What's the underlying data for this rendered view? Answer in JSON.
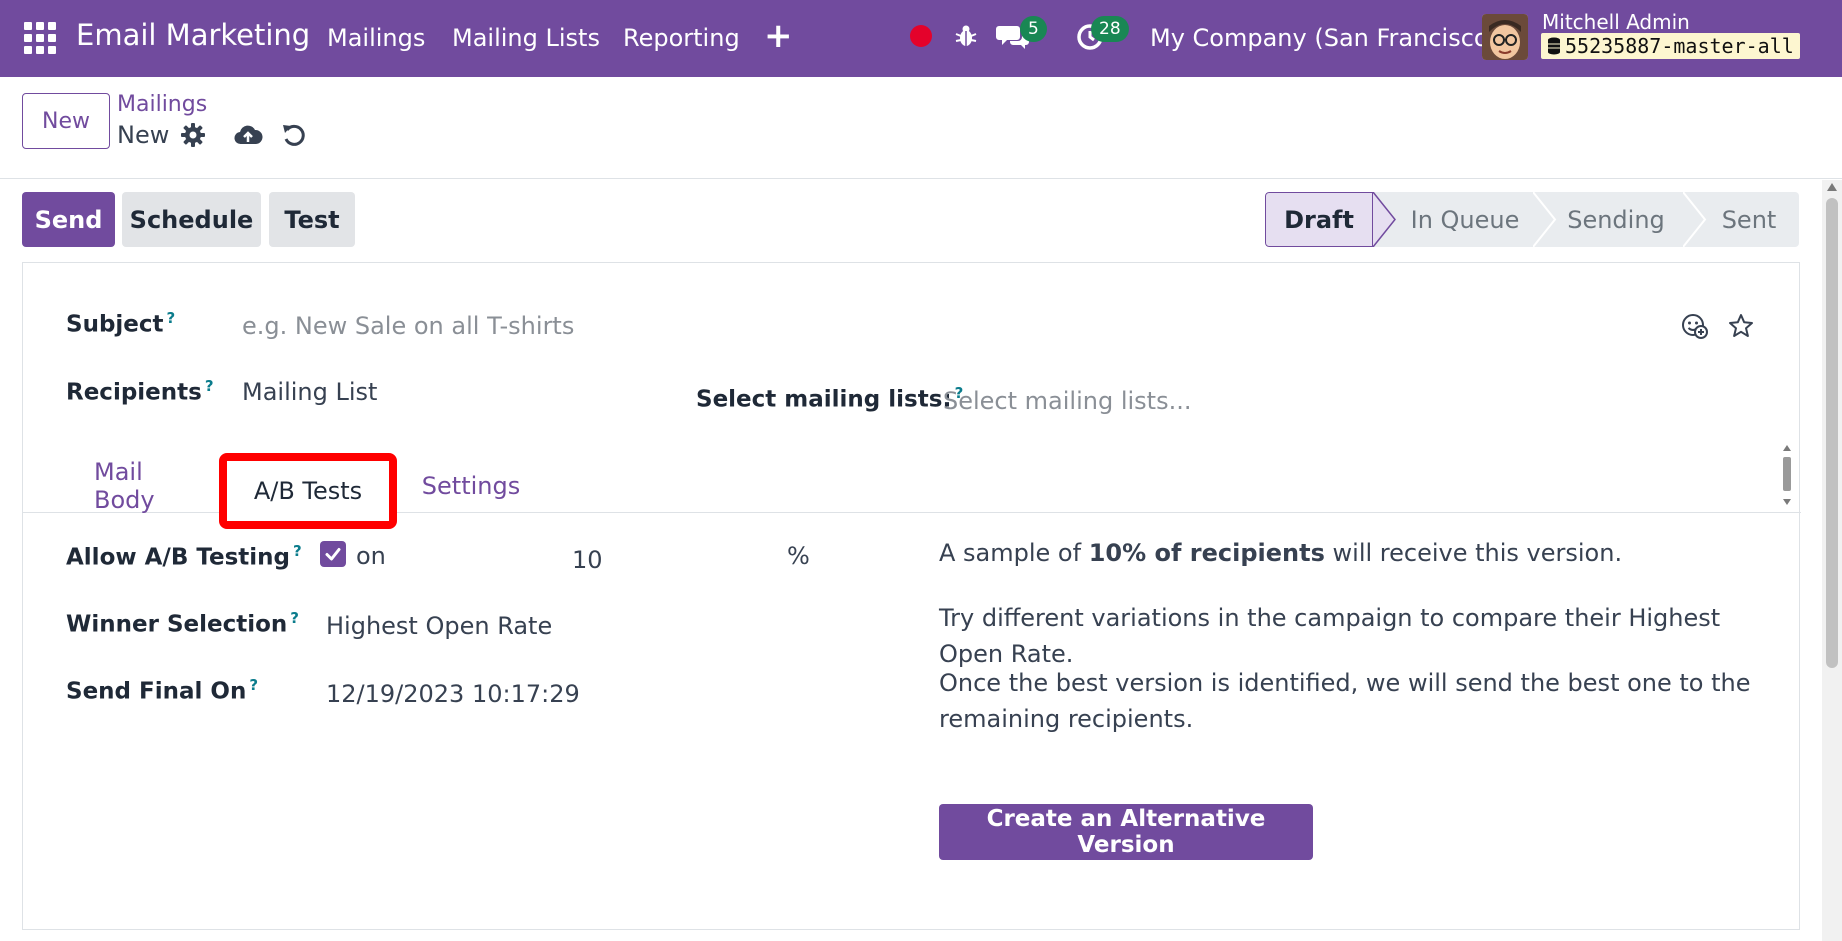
{
  "navbar": {
    "brand": "Email Marketing",
    "menu": [
      "Mailings",
      "Mailing Lists",
      "Reporting"
    ],
    "messages_count": "5",
    "activities_count": "28",
    "company": "My Company (San Francisco)",
    "user_name": "Mitchell Admin",
    "database": "55235887-master-all",
    "colors": {
      "brand": "#714b9e",
      "recording": "#e4022b",
      "badge": "#198754"
    }
  },
  "control_panel": {
    "new_label": "New",
    "breadcrumb_parent": "Mailings",
    "breadcrumb_current": "New"
  },
  "actions": {
    "send_label": "Send",
    "schedule_label": "Schedule",
    "test_label": "Test"
  },
  "statusbar": {
    "stages": [
      "Draft",
      "In Queue",
      "Sending",
      "Sent"
    ],
    "active": "Draft"
  },
  "form": {
    "subject_label": "Subject",
    "subject_placeholder": "e.g. New Sale on all T-shirts",
    "recipients_label": "Recipients",
    "recipients_value": "Mailing List",
    "mailing_lists_label": "Select mailing lists:",
    "mailing_lists_placeholder": "Select mailing lists...",
    "help_mark": "?"
  },
  "tabs": {
    "mail_body": "Mail Body",
    "ab_tests": "A/B Tests",
    "settings": "Settings",
    "active": "A/B Tests"
  },
  "ab_tests": {
    "allow_label": "Allow A/B Testing",
    "allow_checked": true,
    "on_label": "on",
    "percentage_value": "10",
    "percent_sign": "%",
    "winner_label": "Winner Selection",
    "winner_value": "Highest Open Rate",
    "send_final_label": "Send Final On",
    "send_final_value": "12/19/2023 10:17:29",
    "sample_prefix": "A sample of ",
    "sample_bold": "10% of recipients",
    "sample_suffix": " will receive this version.",
    "description_1": "Try different variations in the campaign to compare their Highest Open Rate.",
    "description_2": "Once the best version is identified, we will send the best one to the remaining recipients.",
    "create_button": "Create an Alternative Version"
  }
}
